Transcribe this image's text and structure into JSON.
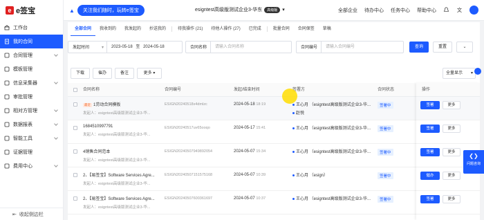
{
  "brand": {
    "logo_char": "e",
    "name": "e签宝"
  },
  "sidebar": {
    "items": [
      {
        "label": "工作台",
        "icon": "home-icon",
        "caret": false,
        "active": false
      },
      {
        "label": "我的合同",
        "icon": "contract-icon",
        "caret": false,
        "active": true
      },
      {
        "label": "合同管理",
        "icon": "file-icon",
        "caret": true,
        "active": false
      },
      {
        "label": "模板管理",
        "icon": "template-icon",
        "caret": false,
        "active": false
      },
      {
        "label": "信息采集器",
        "icon": "collector-icon",
        "caret": true,
        "active": false
      },
      {
        "label": "审批管理",
        "icon": "approval-icon",
        "caret": false,
        "active": false
      },
      {
        "label": "相对方管理",
        "icon": "partner-icon",
        "caret": true,
        "active": false
      },
      {
        "label": "数据报表",
        "icon": "report-icon",
        "caret": true,
        "active": false
      },
      {
        "label": "智能工具",
        "icon": "smart-tool-icon",
        "caret": true,
        "active": false
      },
      {
        "label": "证据管理",
        "icon": "evidence-icon",
        "caret": false,
        "active": false
      },
      {
        "label": "费用中心",
        "icon": "cost-icon",
        "caret": true,
        "active": false
      }
    ],
    "collapse_label": "收起侧边栏"
  },
  "topbar": {
    "follow_label": "关注我们随时，玩转e签宝",
    "company_name": "esigntest高级版测试企业3-华东",
    "company_badge": "高级版",
    "links": [
      "全部企业",
      "待办中心",
      "任务中心",
      "帮助中心"
    ]
  },
  "tabs": [
    {
      "label": "全部合同",
      "active": true
    },
    {
      "label": "我收到的",
      "active": false
    },
    {
      "label": "我发起的",
      "active": false
    },
    {
      "label": "抄送我的",
      "active": false
    },
    {
      "label": "待我操作 (21)",
      "active": false
    },
    {
      "label": "待他人操作 (27)",
      "active": false
    },
    {
      "label": "已完成",
      "active": false
    },
    {
      "label": "批量合同",
      "active": false
    },
    {
      "label": "合同保签",
      "active": false
    },
    {
      "label": "草稿",
      "active": false
    }
  ],
  "filters": {
    "date_type": "发起时间",
    "date_start": "2023-05-18",
    "date_sep": "至",
    "date_end": "2024-05-18",
    "name_label": "合同名称",
    "name_placeholder": "请输入合同名称",
    "code_label": "合同编号",
    "code_placeholder": "请输入合同编号",
    "search_label": "查询",
    "reset_label": "重置"
  },
  "actions": {
    "download": "下载",
    "urge": "催办",
    "remark": "备注",
    "more": "更多",
    "display_label": "全量显示"
  },
  "table": {
    "headers": [
      "合同名称",
      "合同编号",
      "发起/结束时间",
      "签署方",
      "合同状态",
      "操作"
    ],
    "rows": [
      {
        "recent": "最近",
        "name": "1劳动合同模板",
        "initiator": "发起人：esigntest高级版测试企业3-华...",
        "code": "ESIGN20240518x4dmlzc",
        "date": "2024-05-18",
        "time": "18:19",
        "signers": [
          "王心月 （esigntest高级版测试企业3-华...",
          "赵悦"
        ],
        "status": "签署中",
        "op_primary": "签署",
        "op_more": "更多"
      },
      {
        "recent": "",
        "name": "1684510997791",
        "initiator": "发起人：esigntest高级版测试企业3-华...",
        "code": "ESIGN20240517uv65ooqo",
        "date": "2024-05-17",
        "time": "15:41",
        "signers": [
          "王心月 （esigntest高级版测试企业3-华..."
        ],
        "status": "签署中",
        "op_primary": "签署",
        "op_more": "更多"
      },
      {
        "recent": "",
        "name": "4销售合同范本",
        "initiator": "发起人：esigntest高级版测试企业3-华...",
        "code": "ESIGN20240507949892054",
        "date": "2024-05-07",
        "time": "15:34",
        "signers": [
          "王心月 （esigntest高级版测试企业3-华..."
        ],
        "status": "签署中",
        "op_primary": "签署",
        "op_more": "更多"
      },
      {
        "recent": "",
        "name": "2、【易签宝】Software Services Agre...",
        "initiator": "发起人：esigntest高级版测试企业3-华...",
        "code": "ESIGN20240507151575168",
        "date": "2024-05-07",
        "time": "10:39",
        "signers": [
          "王心月 （esign）"
        ],
        "status": "签署中",
        "op_primary": "催办",
        "op_more": "更多"
      },
      {
        "recent": "",
        "name": "2、【易签宝】Software Services Agre...",
        "initiator": "发起人：esigntest高级版测试企业3-华...",
        "code": "ESIGN20240507600361697",
        "date": "2024-05-07",
        "time": "10:37",
        "signers": [
          "王心月 （esigntest高级版测试企业3-华..."
        ],
        "status": "签署中",
        "op_primary": "签署",
        "op_more": "更多"
      }
    ]
  },
  "help_float": {
    "label": "问题咨询"
  },
  "colors": {
    "primary": "#1d5bff",
    "brand_red": "#e02020"
  }
}
